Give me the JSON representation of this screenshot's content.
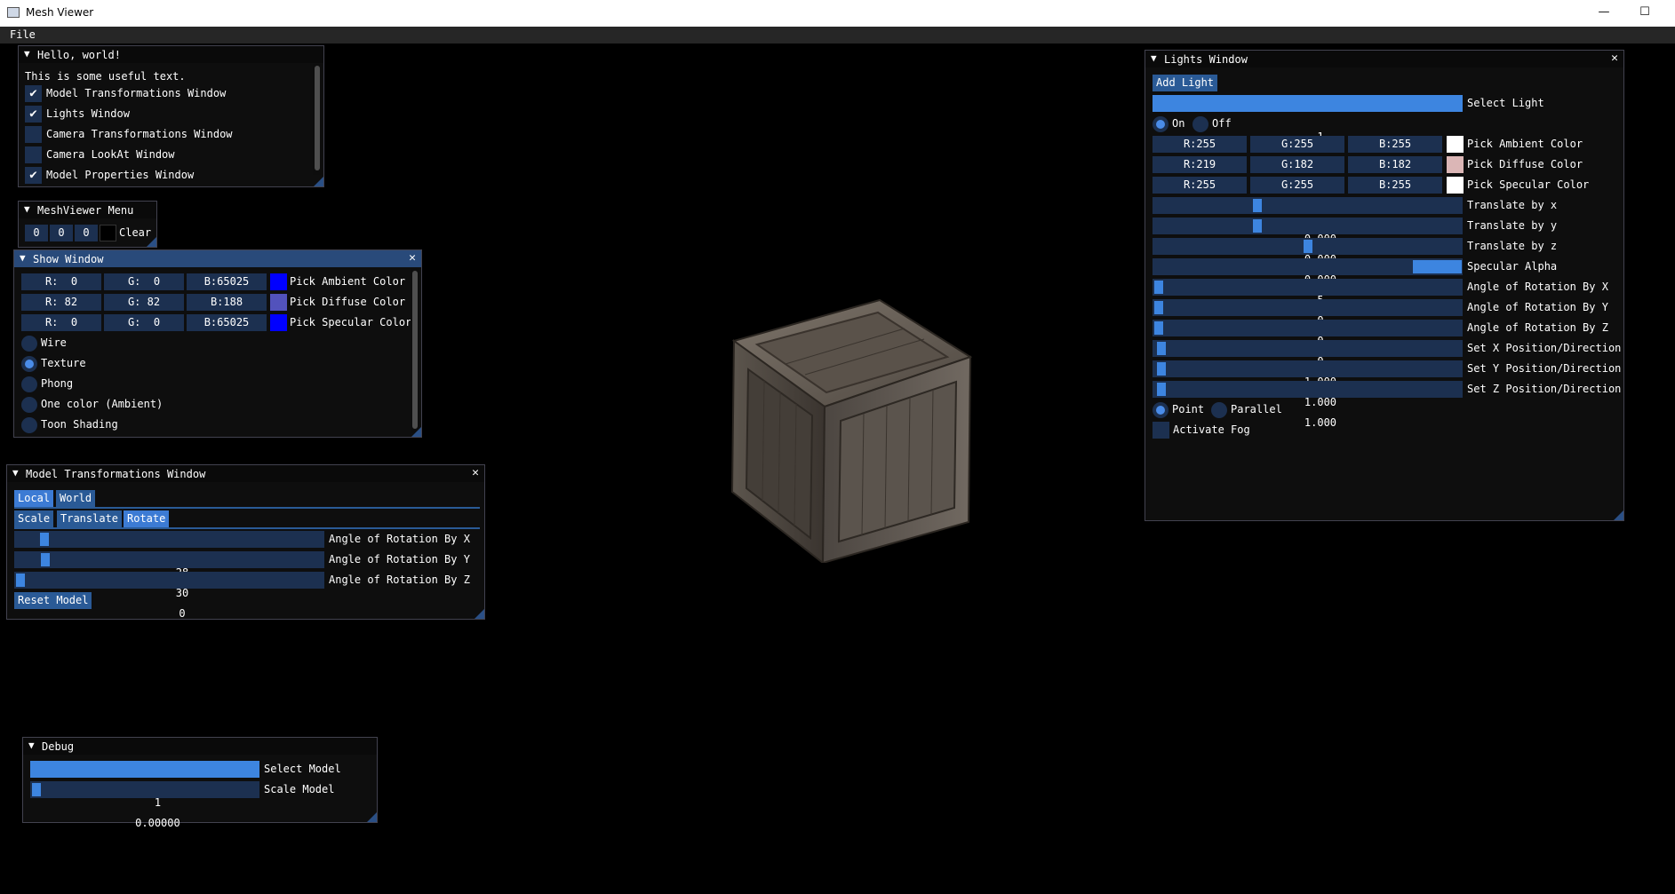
{
  "app": {
    "title": "Mesh Viewer",
    "minimize": "—",
    "maximize": "☐"
  },
  "menubar": {
    "file": "File"
  },
  "hello": {
    "title": "Hello, world!",
    "text": "This is some useful text.",
    "items": [
      {
        "label": "Model Transformations Window",
        "checked": true
      },
      {
        "label": "Lights Window",
        "checked": true
      },
      {
        "label": "Camera Transformations Window",
        "checked": false
      },
      {
        "label": "Camera LookAt Window",
        "checked": false
      },
      {
        "label": "Model Properties Window",
        "checked": true
      }
    ]
  },
  "meshmenu": {
    "title": "MeshViewer Menu",
    "r": "0",
    "g": "0",
    "b": "0",
    "clear": "Clear",
    "color": "#000000"
  },
  "show": {
    "title": "Show Window",
    "close": "✕",
    "rows": [
      {
        "r": "R:  0",
        "g": "G:  0",
        "b": "B:65025",
        "color": "#0000ff",
        "label": "Pick Ambient Color"
      },
      {
        "r": "R: 82",
        "g": "G: 82",
        "b": "B:188",
        "color": "#5252bc",
        "label": "Pick Diffuse Color"
      },
      {
        "r": "R:  0",
        "g": "G:  0",
        "b": "B:65025",
        "color": "#0000ff",
        "label": "Pick Specular Color"
      }
    ],
    "modes": [
      {
        "label": "Wire",
        "selected": false
      },
      {
        "label": "Texture",
        "selected": true
      },
      {
        "label": "Phong",
        "selected": false
      },
      {
        "label": "One color (Ambient)",
        "selected": false
      },
      {
        "label": "Toon Shading",
        "selected": false
      }
    ]
  },
  "modeltx": {
    "title": "Model Transformations Window",
    "close": "✕",
    "tabs_space": [
      "Local",
      "World"
    ],
    "tabs_op": [
      "Scale",
      "Translate",
      "Rotate"
    ],
    "sliders": [
      {
        "value": "28",
        "label": "Angle of Rotation By X",
        "fraction": 0.08
      },
      {
        "value": "30",
        "label": "Angle of Rotation By Y",
        "fraction": 0.085
      },
      {
        "value": "0",
        "label": "Angle of Rotation By Z",
        "fraction": 0.0
      }
    ],
    "reset": "Reset Model"
  },
  "debug": {
    "title": "Debug",
    "select_value": "1",
    "select_label": "Select Model",
    "scale_value": "0.00000",
    "scale_label": "Scale Model",
    "scale_fraction": 0.0
  },
  "lights": {
    "title": "Lights Window",
    "close": "✕",
    "add": "Add Light",
    "select_value": "1",
    "select_label": "Select Light",
    "on": "On",
    "off": "Off",
    "colors": [
      {
        "r": "R:255",
        "g": "G:255",
        "b": "B:255",
        "color": "#ffffff",
        "label": "Pick Ambient Color"
      },
      {
        "r": "R:219",
        "g": "G:182",
        "b": "B:182",
        "color": "#dbb6b6",
        "label": "Pick Diffuse Color"
      },
      {
        "r": "R:255",
        "g": "G:255",
        "b": "B:255",
        "color": "#ffffff",
        "label": "Pick Specular Color"
      }
    ],
    "sliders": [
      {
        "value": "0.000",
        "label": "Translate by x",
        "fraction": 0.33
      },
      {
        "value": "0.000",
        "label": "Translate by y",
        "fraction": 0.33
      },
      {
        "value": "0.000",
        "label": "Translate by z",
        "fraction": 0.5
      },
      {
        "value": "5",
        "label": "Specular Alpha",
        "fraction": 0.84,
        "style": "fillend"
      },
      {
        "value": "0",
        "label": "Angle of Rotation By X",
        "fraction": 0.0
      },
      {
        "value": "0",
        "label": "Angle of Rotation By Y",
        "fraction": 0.0
      },
      {
        "value": "0",
        "label": "Angle of Rotation By Z",
        "fraction": 0.0
      },
      {
        "value": "1.000",
        "label": "Set X Position/Direction",
        "fraction": 0.01
      },
      {
        "value": "1.000",
        "label": "Set Y Position/Direction",
        "fraction": 0.01
      },
      {
        "value": "1.000",
        "label": "Set Z Position/Direction",
        "fraction": 0.01
      }
    ],
    "point": "Point",
    "parallel": "Parallel",
    "fog": "Activate Fog"
  }
}
